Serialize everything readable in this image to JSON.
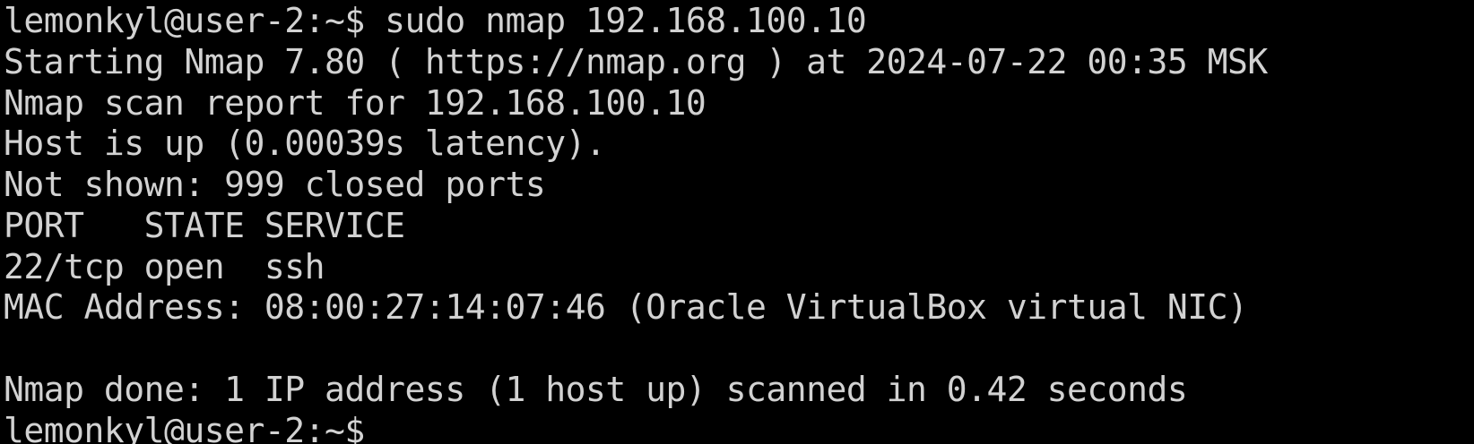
{
  "terminal": {
    "lines": [
      "lemonkyl@user-2:~$ sudo nmap 192.168.100.10",
      "Starting Nmap 7.80 ( https://nmap.org ) at 2024-07-22 00:35 MSK",
      "Nmap scan report for 192.168.100.10",
      "Host is up (0.00039s latency).",
      "Not shown: 999 closed ports",
      "PORT   STATE SERVICE",
      "22/tcp open  ssh",
      "MAC Address: 08:00:27:14:07:46 (Oracle VirtualBox virtual NIC)",
      "",
      "Nmap done: 1 IP address (1 host up) scanned in 0.42 seconds",
      "lemonkyl@user-2:~$"
    ],
    "colors": {
      "background": "#000000",
      "foreground": "#d2d2d2"
    }
  }
}
